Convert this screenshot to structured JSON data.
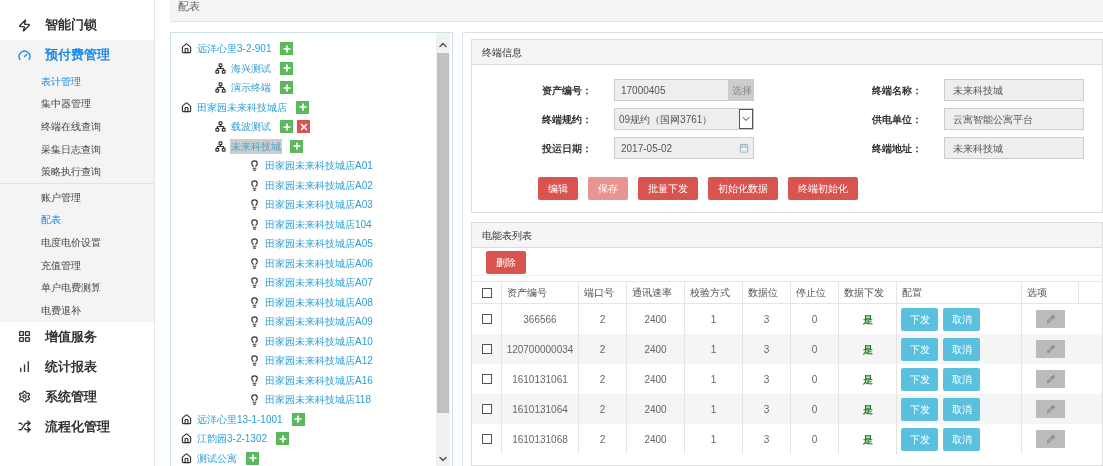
{
  "sidebar": {
    "items": [
      {
        "label": "智能门锁",
        "expanded": false
      },
      {
        "label": "预付费管理",
        "expanded": true,
        "groups": [
          [
            {
              "label": "表计管理",
              "selected": true
            },
            {
              "label": "集中器管理",
              "selected": false
            },
            {
              "label": "终端在线查询",
              "selected": false
            },
            {
              "label": "采集日志查询",
              "selected": false
            },
            {
              "label": "策略执行查询",
              "selected": false
            }
          ],
          [
            {
              "label": "账户管理",
              "selected": false
            },
            {
              "label": "配表",
              "selected": true
            },
            {
              "label": "电度电价设置",
              "selected": false
            },
            {
              "label": "充值管理",
              "selected": false
            },
            {
              "label": "单户电费测算",
              "selected": false
            },
            {
              "label": "电费退补",
              "selected": false
            }
          ]
        ]
      },
      {
        "label": "增值服务",
        "expanded": false
      },
      {
        "label": "统计报表",
        "expanded": false
      },
      {
        "label": "系统管理",
        "expanded": false
      },
      {
        "label": "流程化管理",
        "expanded": false
      }
    ]
  },
  "page_title": "配表",
  "tree": [
    {
      "label": "远洋心里3-2-901",
      "kind": "home",
      "selected": false,
      "addable": true,
      "deletable": false,
      "children": [
        {
          "label": "海兴测试",
          "kind": "branch",
          "selected": false,
          "addable": true,
          "deletable": false
        },
        {
          "label": "演示终端",
          "kind": "branch",
          "selected": false,
          "addable": true,
          "deletable": false
        }
      ]
    },
    {
      "label": "田家园未来科技城店",
      "kind": "home",
      "selected": false,
      "addable": true,
      "deletable": false,
      "children": [
        {
          "label": "载波测试",
          "kind": "branch",
          "selected": false,
          "addable": true,
          "deletable": true
        },
        {
          "label": "未来科技城",
          "kind": "branch",
          "selected": true,
          "addable": true,
          "deletable": false,
          "children": [
            {
              "label": "田家园未来科技城店A01",
              "kind": "meter",
              "selected": false
            },
            {
              "label": "田家园未来科技城店A02",
              "kind": "meter",
              "selected": false
            },
            {
              "label": "田家园未来科技城店A03",
              "kind": "meter",
              "selected": false
            },
            {
              "label": "田家园未来科技城店104",
              "kind": "meter",
              "selected": false
            },
            {
              "label": "田家园未来科技城店A05",
              "kind": "meter",
              "selected": false
            },
            {
              "label": "田家园未来科技城店A06",
              "kind": "meter",
              "selected": false
            },
            {
              "label": "田家园未来科技城店A07",
              "kind": "meter",
              "selected": false
            },
            {
              "label": "田家园未来科技城店A08",
              "kind": "meter",
              "selected": false
            },
            {
              "label": "田家园未来科技城店A09",
              "kind": "meter",
              "selected": false
            },
            {
              "label": "田家园未来科技城店A10",
              "kind": "meter",
              "selected": false
            },
            {
              "label": "田家园未来科技城店A12",
              "kind": "meter",
              "selected": false
            },
            {
              "label": "田家园未来科技城店A16",
              "kind": "meter",
              "selected": false
            },
            {
              "label": "田家园未来科技城店118",
              "kind": "meter",
              "selected": false
            }
          ]
        }
      ]
    },
    {
      "label": "远洋心里13-1-1001",
      "kind": "home",
      "selected": false,
      "addable": true,
      "deletable": false
    },
    {
      "label": "江韵园3-2-1302",
      "kind": "home",
      "selected": false,
      "addable": true,
      "deletable": false
    },
    {
      "label": "测试公寓",
      "kind": "home",
      "selected": false,
      "addable": true,
      "deletable": false
    }
  ],
  "terminal_info": {
    "title": "终端信息",
    "fields": [
      {
        "label": "资产编号：",
        "value": "17000405",
        "kind": "picker",
        "button": "选择"
      },
      {
        "label": "终端名称：",
        "value": "未来科技城",
        "kind": "text"
      },
      {
        "label": "终端规约：",
        "value": "09规约（国网3761）",
        "kind": "select"
      },
      {
        "label": "供电单位：",
        "value": "云寓智能公寓平台",
        "kind": "text"
      },
      {
        "label": "投运日期：",
        "value": "2017-05-02",
        "kind": "date"
      },
      {
        "label": "终端地址：",
        "value": "未来科技城",
        "kind": "text"
      }
    ],
    "buttons": [
      {
        "label": "编辑",
        "disabled": false
      },
      {
        "label": "保存",
        "disabled": true
      },
      {
        "label": "批量下发",
        "disabled": false
      },
      {
        "label": "初始化数据",
        "disabled": false
      },
      {
        "label": "终端初始化",
        "disabled": false
      }
    ]
  },
  "meter_list": {
    "title": "电能表列表",
    "delete_button": "删除",
    "columns": [
      "资产编号",
      "端口号",
      "通讯速率",
      "校验方式",
      "数据位",
      "停止位",
      "数据下发",
      "配置",
      "选项"
    ],
    "all_checked": false,
    "rows": [
      {
        "checked": false,
        "cells": [
          "366566",
          "2",
          "2400",
          "1",
          "3",
          "0",
          "是"
        ],
        "actions": [
          "下发",
          "取消"
        ]
      },
      {
        "checked": false,
        "cells": [
          "120700000034",
          "2",
          "2400",
          "1",
          "3",
          "0",
          "是"
        ],
        "actions": [
          "下发",
          "取消"
        ]
      },
      {
        "checked": false,
        "cells": [
          "1610131061",
          "2",
          "2400",
          "1",
          "3",
          "0",
          "是"
        ],
        "actions": [
          "下发",
          "取消"
        ]
      },
      {
        "checked": false,
        "cells": [
          "1610131064",
          "2",
          "2400",
          "1",
          "3",
          "0",
          "是"
        ],
        "actions": [
          "下发",
          "取消"
        ]
      },
      {
        "checked": false,
        "cells": [
          "1610131068",
          "2",
          "2400",
          "1",
          "3",
          "0",
          "是"
        ],
        "actions": [
          "下发",
          "取消"
        ]
      }
    ]
  }
}
